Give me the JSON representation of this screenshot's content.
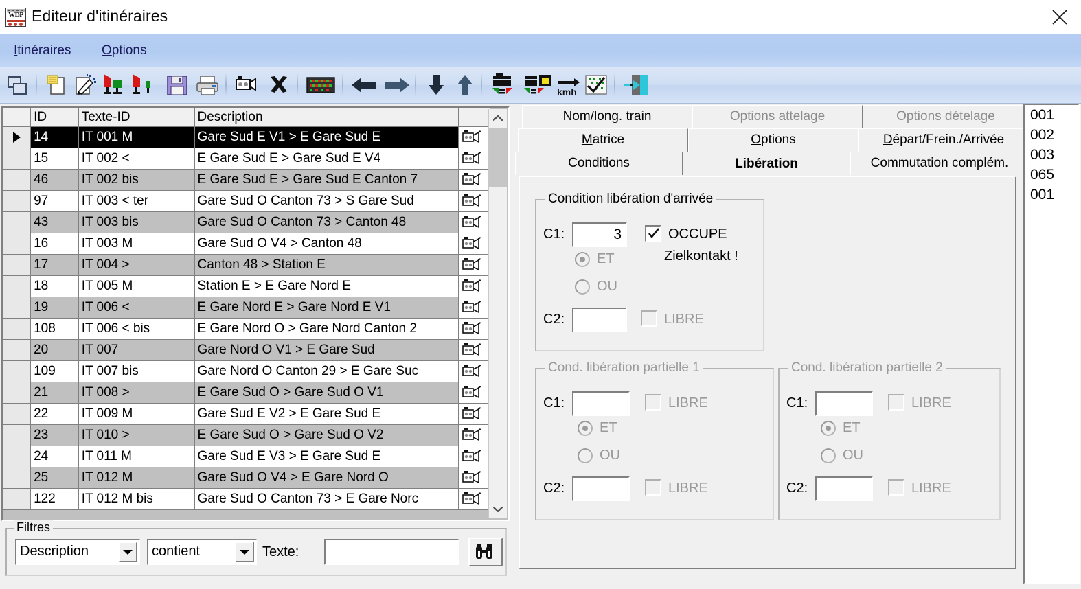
{
  "window": {
    "title": "Editeur d'itinéraires",
    "icon": "wdp-locomotive-icon",
    "close_label": "✕"
  },
  "menu": {
    "items": [
      {
        "name": "itineraires",
        "label": "Itinéraires",
        "accel": "I"
      },
      {
        "name": "options",
        "label": "Options",
        "accel": "O"
      }
    ]
  },
  "toolbar": {
    "buttons": [
      {
        "name": "print-preview-icon",
        "title": "Aperçu"
      },
      {
        "name": "new-document-icon",
        "title": "Nouveau"
      },
      {
        "name": "edit-document-icon",
        "title": "Modifier"
      },
      {
        "name": "train-signals-green-icon",
        "title": "Itinéraire"
      },
      {
        "name": "train-signal-single-icon",
        "title": "Itinéraire simple"
      },
      {
        "name": "save-icon",
        "title": "Enregistrer"
      },
      {
        "name": "print-icon",
        "title": "Imprimer"
      },
      {
        "name": "camera-icon",
        "title": "Capture"
      },
      {
        "name": "delete-x-icon",
        "title": "Supprimer"
      },
      {
        "name": "matrix-grid-icon",
        "title": "Matrice"
      },
      {
        "name": "arrow-left-icon",
        "title": "Précédent"
      },
      {
        "name": "arrow-right-icon",
        "title": "Suivant"
      },
      {
        "name": "arrow-down-icon",
        "title": "Bas"
      },
      {
        "name": "arrow-up-icon",
        "title": "Haut"
      },
      {
        "name": "train-speed-icon",
        "title": "Vitesse"
      },
      {
        "name": "train-speed-display-icon",
        "title": "Affichage vitesse"
      },
      {
        "name": "kmh-arrow-icon",
        "title": "km/h"
      },
      {
        "name": "chart-check-icon",
        "title": "Graphique"
      },
      {
        "name": "exit-door-icon",
        "title": "Quitter"
      }
    ]
  },
  "grid": {
    "columns": [
      "",
      "ID",
      "Texte-ID",
      "Description",
      ""
    ],
    "rows": [
      {
        "sel": true,
        "id": "14",
        "texte_id": "IT 001 M",
        "description": "Gare Sud  E V1 > E Gare Sud E"
      },
      {
        "sel": false,
        "id": "15",
        "texte_id": "IT 002 <",
        "description": "E Gare Sud E > Gare Sud E V4"
      },
      {
        "sel": false,
        "id": "46",
        "texte_id": "IT 002 bis",
        "description": "E Gare Sud E > Gare Sud E Canton 7"
      },
      {
        "sel": false,
        "id": "97",
        "texte_id": "IT 003 < ter",
        "description": "Gare Sud O Canton 73 > S Gare Sud"
      },
      {
        "sel": false,
        "id": "43",
        "texte_id": "IT 003 bis",
        "description": "Gare Sud O Canton 73 > Canton 48"
      },
      {
        "sel": false,
        "id": "16",
        "texte_id": "IT 003 M",
        "description": "Gare Sud O V4 > Canton 48"
      },
      {
        "sel": false,
        "id": "17",
        "texte_id": "IT 004 >",
        "description": "Canton 48 > Station E"
      },
      {
        "sel": false,
        "id": "18",
        "texte_id": "IT 005 M",
        "description": "Station E > E Gare Nord E"
      },
      {
        "sel": false,
        "id": "19",
        "texte_id": "IT 006 <",
        "description": "E Gare Nord E > Gare Nord E V1"
      },
      {
        "sel": false,
        "id": "108",
        "texte_id": "IT 006 < bis",
        "description": "E Gare Nord O > Gare Nord Canton 2"
      },
      {
        "sel": false,
        "id": "20",
        "texte_id": "IT 007",
        "description": "Gare Nord O V1 > E Gare Sud"
      },
      {
        "sel": false,
        "id": "109",
        "texte_id": "IT 007 bis",
        "description": "Gare Nord O Canton 29 > E Gare Suc"
      },
      {
        "sel": false,
        "id": "21",
        "texte_id": "IT 008 >",
        "description": "E Gare Sud O > Gare Sud O V1"
      },
      {
        "sel": false,
        "id": "22",
        "texte_id": "IT 009 M",
        "description": "Gare Sud E V2 > E Gare Sud E"
      },
      {
        "sel": false,
        "id": "23",
        "texte_id": "IT 010 >",
        "description": "E Gare Sud O > Gare Sud O V2"
      },
      {
        "sel": false,
        "id": "24",
        "texte_id": "IT 011 M",
        "description": "Gare Sud E V3 > E Gare Sud E"
      },
      {
        "sel": false,
        "id": "25",
        "texte_id": "IT 012 M",
        "description": "Gare Sud O V4 > E Gare Nord O"
      },
      {
        "sel": false,
        "id": "122",
        "texte_id": "IT 012 M bis",
        "description": "Gare Sud O Canton 73 > E Gare Norc"
      }
    ]
  },
  "filters": {
    "group_title": "Filtres",
    "field_value": "Description",
    "operator_value": "contient",
    "text_label": "Texte:",
    "text_value": "",
    "search_icon": "binoculars-icon"
  },
  "tabs": {
    "row1": [
      {
        "name": "nom-long-train",
        "label": "Nom/long. train",
        "state": "normal",
        "accel": ""
      },
      {
        "name": "options-attelage",
        "label": "Options attelage",
        "state": "disabled",
        "accel": ""
      },
      {
        "name": "options-detelage",
        "label": "Options dételage",
        "state": "disabled",
        "accel": ""
      }
    ],
    "row2": [
      {
        "name": "matrice",
        "label": "Matrice",
        "state": "normal",
        "accel": "M"
      },
      {
        "name": "options",
        "label": "Options",
        "state": "normal",
        "accel": "O"
      },
      {
        "name": "depart-frein-arrivee",
        "label": "Départ/Frein./Arrivée",
        "state": "normal",
        "accel": "D"
      }
    ],
    "row3": [
      {
        "name": "conditions",
        "label": "Conditions",
        "state": "normal",
        "accel": "C"
      },
      {
        "name": "liberation",
        "label": "Libération",
        "state": "selected",
        "accel": ""
      },
      {
        "name": "commutation-complem",
        "label": "Commutation complém.",
        "state": "normal",
        "accel": "é"
      }
    ]
  },
  "liberation": {
    "arrival": {
      "title": "Condition libération d'arrivée",
      "c1_label": "C1:",
      "c1_value": "3",
      "c1_checkbox_label": "OCCUPE",
      "c1_checkbox_checked": true,
      "note": "Zielkontakt !",
      "radio_et": "ET",
      "radio_ou": "OU",
      "radio_selected": "ET",
      "c2_label": "C2:",
      "c2_value": "",
      "c2_checkbox_label": "LIBRE",
      "c2_checkbox_checked": false
    },
    "partial1": {
      "title": "Cond. libération partielle 1",
      "c1_label": "C1:",
      "c1_value": "",
      "c1_checkbox_label": "LIBRE",
      "radio_et": "ET",
      "radio_ou": "OU",
      "radio_selected": "ET",
      "c2_label": "C2:",
      "c2_value": "",
      "c2_checkbox_label": "LIBRE"
    },
    "partial2": {
      "title": "Cond. libération partielle  2",
      "c1_label": "C1:",
      "c1_value": "",
      "c1_checkbox_label": "LIBRE",
      "radio_et": "ET",
      "radio_ou": "OU",
      "radio_selected": "ET",
      "c2_label": "C2:",
      "c2_value": "",
      "c2_checkbox_label": "LIBRE"
    }
  },
  "right_list": {
    "items": [
      "001",
      "002",
      "003",
      "065",
      "001"
    ]
  },
  "colors": {
    "menubar": "#b4ccf1",
    "toolbar": "#cfdef3",
    "face": "#f0f0f0",
    "grid_alt": "#c0c0c0",
    "selection_bg": "#000000",
    "selection_fg": "#ffffff",
    "disabled_text": "#9a9a9a",
    "menu_text": "#1a1a5e"
  }
}
